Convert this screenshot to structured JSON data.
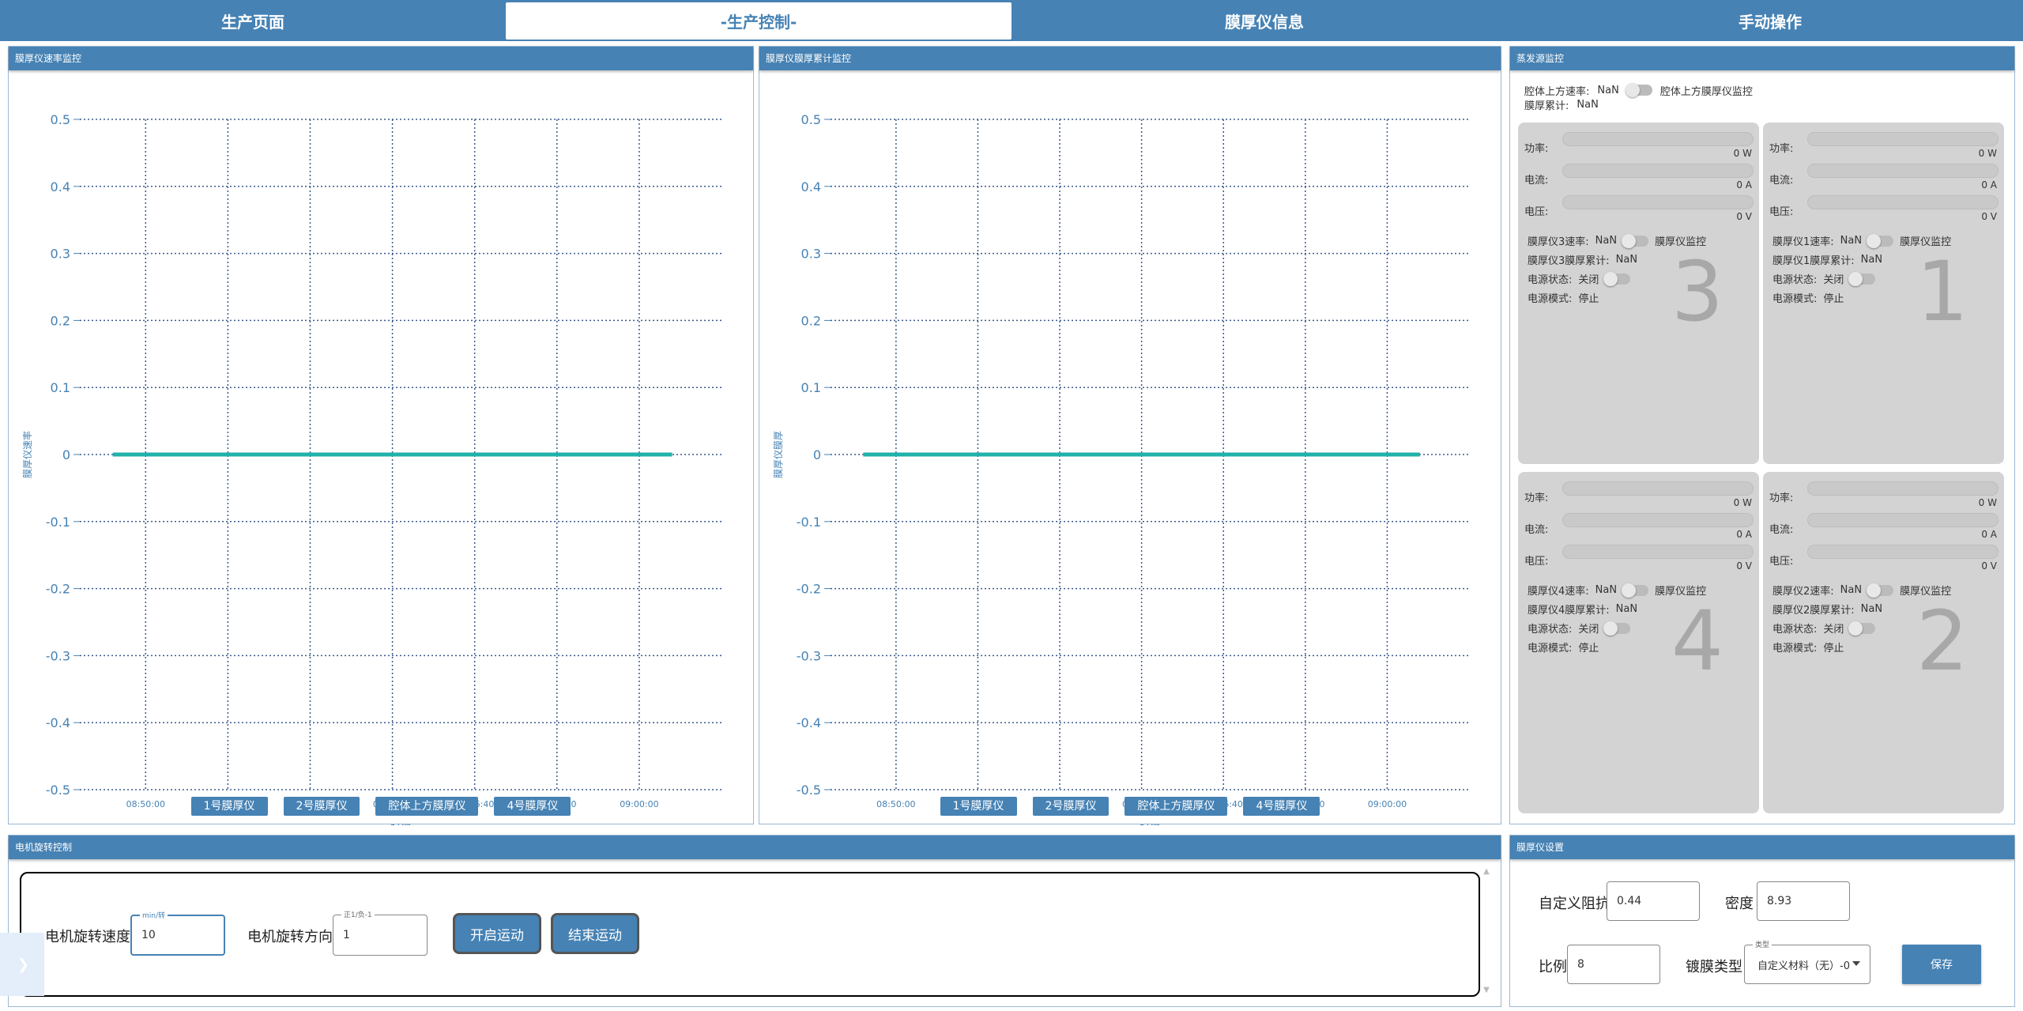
{
  "tabs": [
    {
      "label": "生产页面"
    },
    {
      "label": "-生产控制-"
    },
    {
      "label": "膜厚仪信息"
    },
    {
      "label": "手动操作"
    }
  ],
  "rate_panel": {
    "title": "膜厚仪速率监控",
    "legend": [
      "1号膜厚仪",
      "2号膜厚仪",
      "腔体上方膜厚仪",
      "4号膜厚仪"
    ]
  },
  "thick_panel": {
    "title": "膜厚仪膜厚累计监控",
    "legend": [
      "1号膜厚仪",
      "2号膜厚仪",
      "腔体上方膜厚仪",
      "4号膜厚仪"
    ]
  },
  "chart_data": [
    {
      "type": "line",
      "title": "膜厚仪速率监控",
      "xlabel": "时间",
      "ylabel": "膜厚仪速率",
      "ylim": [
        -0.5,
        0.5
      ],
      "yticks": [
        "0.5",
        "0.4",
        "0.3",
        "0.2",
        "0.1",
        "0",
        "-0.1",
        "-0.2",
        "-0.3",
        "-0.4",
        "-0.5"
      ],
      "xticks": [
        "08:50:00",
        "08:51:40",
        "08:53:20",
        "08:55:00",
        "08:56:40",
        "08:58:20",
        "09:00:00"
      ],
      "grid": true,
      "series": [
        {
          "values": [
            0,
            0
          ],
          "x": [
            "08:49:20",
            "09:00:40"
          ],
          "color": "#20b2aa"
        }
      ]
    },
    {
      "type": "line",
      "title": "膜厚仪膜厚累计监控",
      "xlabel": "时间",
      "ylabel": "膜厚仪膜厚",
      "ylim": [
        -0.5,
        0.5
      ],
      "yticks": [
        "0.5",
        "0.4",
        "0.3",
        "0.2",
        "0.1",
        "0",
        "-0.1",
        "-0.2",
        "-0.3",
        "-0.4",
        "-0.5"
      ],
      "xticks": [
        "08:50:00",
        "08:51:40",
        "08:53:20",
        "08:55:00",
        "08:56:40",
        "08:58:20",
        "09:00:00"
      ],
      "grid": true,
      "series": [
        {
          "values": [
            0,
            0
          ],
          "x": [
            "08:49:20",
            "09:00:40"
          ],
          "color": "#20b2aa"
        }
      ]
    }
  ],
  "evap": {
    "title": "蒸发源监控",
    "top_rate_label": "腔体上方速率:",
    "top_rate_value": "NaN",
    "top_monitor_label": "腔体上方膜厚仪监控",
    "top_thick_label": "膜厚累计:",
    "top_thick_value": "NaN",
    "cards": [
      {
        "num": "3",
        "power_label": "功率:",
        "power_value": "0 W",
        "current_label": "电流:",
        "current_value": "0 A",
        "voltage_label": "电压:",
        "voltage_value": "0 V",
        "rate_label": "膜厚仪3速率:",
        "rate_value": "NaN",
        "monitor_label": "膜厚仪监控",
        "thick_label": "膜厚仪3膜厚累计:",
        "thick_value": "NaN",
        "state_label": "电源状态:",
        "state_value": "关闭",
        "mode_label": "电源模式:",
        "mode_value": "停止"
      },
      {
        "num": "1",
        "power_label": "功率:",
        "power_value": "0 W",
        "current_label": "电流:",
        "current_value": "0 A",
        "voltage_label": "电压:",
        "voltage_value": "0 V",
        "rate_label": "膜厚仪1速率:",
        "rate_value": "NaN",
        "monitor_label": "膜厚仪监控",
        "thick_label": "膜厚仪1膜厚累计:",
        "thick_value": "NaN",
        "state_label": "电源状态:",
        "state_value": "关闭",
        "mode_label": "电源模式:",
        "mode_value": "停止"
      },
      {
        "num": "4",
        "power_label": "功率:",
        "power_value": "0 W",
        "current_label": "电流:",
        "current_value": "0 A",
        "voltage_label": "电压:",
        "voltage_value": "0 V",
        "rate_label": "膜厚仪4速率:",
        "rate_value": "NaN",
        "monitor_label": "膜厚仪监控",
        "thick_label": "膜厚仪4膜厚累计:",
        "thick_value": "NaN",
        "state_label": "电源状态:",
        "state_value": "关闭",
        "mode_label": "电源模式:",
        "mode_value": "停止"
      },
      {
        "num": "2",
        "power_label": "功率:",
        "power_value": "0 W",
        "current_label": "电流:",
        "current_value": "0 A",
        "voltage_label": "电压:",
        "voltage_value": "0 V",
        "rate_label": "膜厚仪2速率:",
        "rate_value": "NaN",
        "monitor_label": "膜厚仪监控",
        "thick_label": "膜厚仪2膜厚累计:",
        "thick_value": "NaN",
        "state_label": "电源状态:",
        "state_value": "关闭",
        "mode_label": "电源模式:",
        "mode_value": "停止"
      }
    ]
  },
  "motor": {
    "title": "电机旋转控制",
    "speed_label": "电机旋转速度",
    "speed_float": "min/转",
    "speed_value": "10",
    "dir_label": "电机旋转方向",
    "dir_float": "正1/负-1",
    "dir_value": "1",
    "start_label": "开启运动",
    "stop_label": "结束运动",
    "side_icon": "chevron-right-icon"
  },
  "settings": {
    "title": "膜厚仪设置",
    "impedance_label": "自定义阻抗",
    "impedance_value": "0.44",
    "density_label": "密度",
    "density_value": "8.93",
    "ratio_label": "比例",
    "ratio_value": "8",
    "coating_label": "镀膜类型",
    "coating_float": "类型",
    "coating_value": "自定义材料（无）-0",
    "save_label": "保存"
  }
}
